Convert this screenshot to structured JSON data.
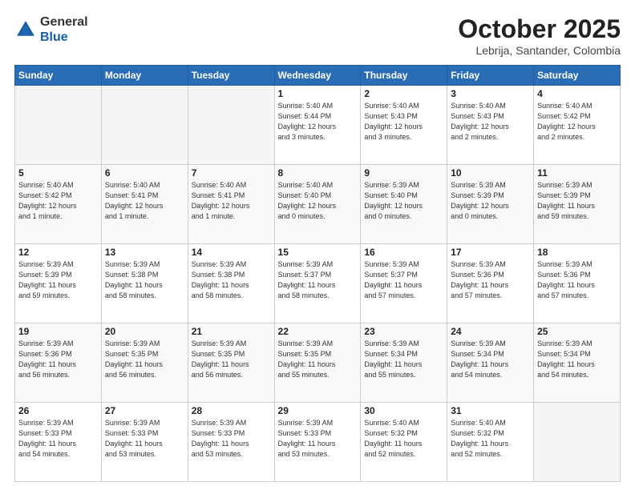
{
  "logo": {
    "general": "General",
    "blue": "Blue"
  },
  "header": {
    "month": "October 2025",
    "location": "Lebrija, Santander, Colombia"
  },
  "weekdays": [
    "Sunday",
    "Monday",
    "Tuesday",
    "Wednesday",
    "Thursday",
    "Friday",
    "Saturday"
  ],
  "weeks": [
    [
      {
        "day": "",
        "info": "",
        "empty": true
      },
      {
        "day": "",
        "info": "",
        "empty": true
      },
      {
        "day": "",
        "info": "",
        "empty": true
      },
      {
        "day": "1",
        "info": "Sunrise: 5:40 AM\nSunset: 5:44 PM\nDaylight: 12 hours\nand 3 minutes.",
        "empty": false
      },
      {
        "day": "2",
        "info": "Sunrise: 5:40 AM\nSunset: 5:43 PM\nDaylight: 12 hours\nand 3 minutes.",
        "empty": false
      },
      {
        "day": "3",
        "info": "Sunrise: 5:40 AM\nSunset: 5:43 PM\nDaylight: 12 hours\nand 2 minutes.",
        "empty": false
      },
      {
        "day": "4",
        "info": "Sunrise: 5:40 AM\nSunset: 5:42 PM\nDaylight: 12 hours\nand 2 minutes.",
        "empty": false
      }
    ],
    [
      {
        "day": "5",
        "info": "Sunrise: 5:40 AM\nSunset: 5:42 PM\nDaylight: 12 hours\nand 1 minute.",
        "empty": false
      },
      {
        "day": "6",
        "info": "Sunrise: 5:40 AM\nSunset: 5:41 PM\nDaylight: 12 hours\nand 1 minute.",
        "empty": false
      },
      {
        "day": "7",
        "info": "Sunrise: 5:40 AM\nSunset: 5:41 PM\nDaylight: 12 hours\nand 1 minute.",
        "empty": false
      },
      {
        "day": "8",
        "info": "Sunrise: 5:40 AM\nSunset: 5:40 PM\nDaylight: 12 hours\nand 0 minutes.",
        "empty": false
      },
      {
        "day": "9",
        "info": "Sunrise: 5:39 AM\nSunset: 5:40 PM\nDaylight: 12 hours\nand 0 minutes.",
        "empty": false
      },
      {
        "day": "10",
        "info": "Sunrise: 5:39 AM\nSunset: 5:39 PM\nDaylight: 12 hours\nand 0 minutes.",
        "empty": false
      },
      {
        "day": "11",
        "info": "Sunrise: 5:39 AM\nSunset: 5:39 PM\nDaylight: 11 hours\nand 59 minutes.",
        "empty": false
      }
    ],
    [
      {
        "day": "12",
        "info": "Sunrise: 5:39 AM\nSunset: 5:39 PM\nDaylight: 11 hours\nand 59 minutes.",
        "empty": false
      },
      {
        "day": "13",
        "info": "Sunrise: 5:39 AM\nSunset: 5:38 PM\nDaylight: 11 hours\nand 58 minutes.",
        "empty": false
      },
      {
        "day": "14",
        "info": "Sunrise: 5:39 AM\nSunset: 5:38 PM\nDaylight: 11 hours\nand 58 minutes.",
        "empty": false
      },
      {
        "day": "15",
        "info": "Sunrise: 5:39 AM\nSunset: 5:37 PM\nDaylight: 11 hours\nand 58 minutes.",
        "empty": false
      },
      {
        "day": "16",
        "info": "Sunrise: 5:39 AM\nSunset: 5:37 PM\nDaylight: 11 hours\nand 57 minutes.",
        "empty": false
      },
      {
        "day": "17",
        "info": "Sunrise: 5:39 AM\nSunset: 5:36 PM\nDaylight: 11 hours\nand 57 minutes.",
        "empty": false
      },
      {
        "day": "18",
        "info": "Sunrise: 5:39 AM\nSunset: 5:36 PM\nDaylight: 11 hours\nand 57 minutes.",
        "empty": false
      }
    ],
    [
      {
        "day": "19",
        "info": "Sunrise: 5:39 AM\nSunset: 5:36 PM\nDaylight: 11 hours\nand 56 minutes.",
        "empty": false
      },
      {
        "day": "20",
        "info": "Sunrise: 5:39 AM\nSunset: 5:35 PM\nDaylight: 11 hours\nand 56 minutes.",
        "empty": false
      },
      {
        "day": "21",
        "info": "Sunrise: 5:39 AM\nSunset: 5:35 PM\nDaylight: 11 hours\nand 56 minutes.",
        "empty": false
      },
      {
        "day": "22",
        "info": "Sunrise: 5:39 AM\nSunset: 5:35 PM\nDaylight: 11 hours\nand 55 minutes.",
        "empty": false
      },
      {
        "day": "23",
        "info": "Sunrise: 5:39 AM\nSunset: 5:34 PM\nDaylight: 11 hours\nand 55 minutes.",
        "empty": false
      },
      {
        "day": "24",
        "info": "Sunrise: 5:39 AM\nSunset: 5:34 PM\nDaylight: 11 hours\nand 54 minutes.",
        "empty": false
      },
      {
        "day": "25",
        "info": "Sunrise: 5:39 AM\nSunset: 5:34 PM\nDaylight: 11 hours\nand 54 minutes.",
        "empty": false
      }
    ],
    [
      {
        "day": "26",
        "info": "Sunrise: 5:39 AM\nSunset: 5:33 PM\nDaylight: 11 hours\nand 54 minutes.",
        "empty": false
      },
      {
        "day": "27",
        "info": "Sunrise: 5:39 AM\nSunset: 5:33 PM\nDaylight: 11 hours\nand 53 minutes.",
        "empty": false
      },
      {
        "day": "28",
        "info": "Sunrise: 5:39 AM\nSunset: 5:33 PM\nDaylight: 11 hours\nand 53 minutes.",
        "empty": false
      },
      {
        "day": "29",
        "info": "Sunrise: 5:39 AM\nSunset: 5:33 PM\nDaylight: 11 hours\nand 53 minutes.",
        "empty": false
      },
      {
        "day": "30",
        "info": "Sunrise: 5:40 AM\nSunset: 5:32 PM\nDaylight: 11 hours\nand 52 minutes.",
        "empty": false
      },
      {
        "day": "31",
        "info": "Sunrise: 5:40 AM\nSunset: 5:32 PM\nDaylight: 11 hours\nand 52 minutes.",
        "empty": false
      },
      {
        "day": "",
        "info": "",
        "empty": true
      }
    ]
  ]
}
